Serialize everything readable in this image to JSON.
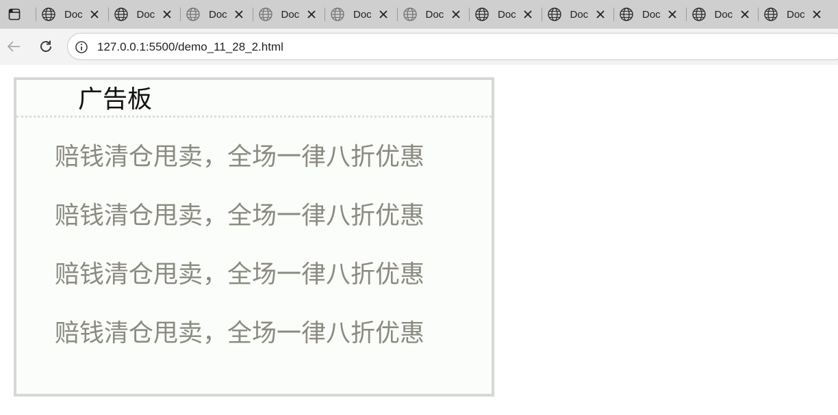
{
  "browser": {
    "tabs": [
      {
        "title": "Doc",
        "active": false,
        "dim": false
      },
      {
        "title": "Doc",
        "active": false,
        "dim": false
      },
      {
        "title": "Doc",
        "active": false,
        "dim": true
      },
      {
        "title": "Doc",
        "active": false,
        "dim": true
      },
      {
        "title": "Doc",
        "active": false,
        "dim": true
      },
      {
        "title": "Doc",
        "active": false,
        "dim": true
      },
      {
        "title": "Doc",
        "active": false,
        "dim": false
      },
      {
        "title": "Doc",
        "active": false,
        "dim": false
      },
      {
        "title": "Doc",
        "active": false,
        "dim": false
      },
      {
        "title": "Doc",
        "active": false,
        "dim": false
      },
      {
        "title": "Doc",
        "active": false,
        "dim": false
      }
    ],
    "address": "127.0.0.1:5500/demo_11_28_2.html",
    "icons": {
      "tab_actions": "tab-actions-icon",
      "tab_favicon": "globe-icon",
      "tab_close": "close-icon",
      "back": "back-arrow-icon",
      "reload": "reload-icon",
      "site_info": "info-icon"
    }
  },
  "page": {
    "board_title": "广告板",
    "promos": [
      "赔钱清仓甩卖，全场一律八折优惠",
      "赔钱清仓甩卖，全场一律八折优惠",
      "赔钱清仓甩卖，全场一律八折优惠",
      "赔钱清仓甩卖，全场一律八折优惠"
    ],
    "colors": {
      "board_border": "#d7d7d7",
      "board_background": "#fbfdfa",
      "promo_text": "#8a8a80",
      "title_text": "#111111"
    }
  }
}
